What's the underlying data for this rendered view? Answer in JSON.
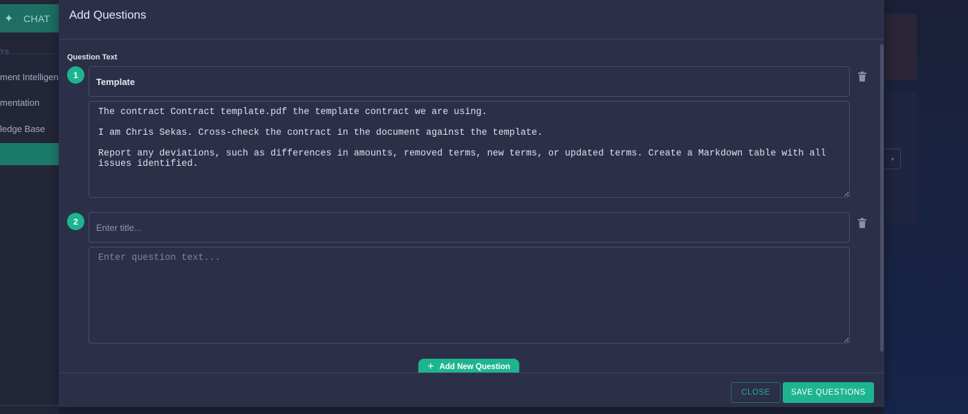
{
  "background": {
    "chat_label": "CHAT",
    "section_label": "TS",
    "nav": [
      {
        "label": "ment Intelligen"
      },
      {
        "label": "mentation"
      },
      {
        "label": "ledge Base"
      }
    ]
  },
  "modal": {
    "title": "Add Questions",
    "question_text_label": "Question Text",
    "questions": [
      {
        "number": "1",
        "title_value": "Template",
        "title_placeholder": "Enter title...",
        "text_value": "The contract Contract template.pdf the template contract we are using.\n\nI am Chris Sekas. Cross-check the contract in the document against the template.\n\nReport any deviations, such as differences in amounts, removed terms, new terms, or updated terms. Create a Markdown table with all issues identified.",
        "text_placeholder": "Enter question text..."
      },
      {
        "number": "2",
        "title_value": "",
        "title_placeholder": "Enter title...",
        "text_value": "",
        "text_placeholder": "Enter question text..."
      }
    ],
    "add_button_label": "Add New Question",
    "footer": {
      "close_label": "CLOSE",
      "save_label": "SAVE QUESTIONS"
    }
  },
  "colors": {
    "accent": "#1db58f",
    "modal_bg": "#2c2f48",
    "border": "#4a4e6a"
  },
  "icons": [
    "sparkle-icon",
    "trash-icon",
    "plus-icon"
  ]
}
